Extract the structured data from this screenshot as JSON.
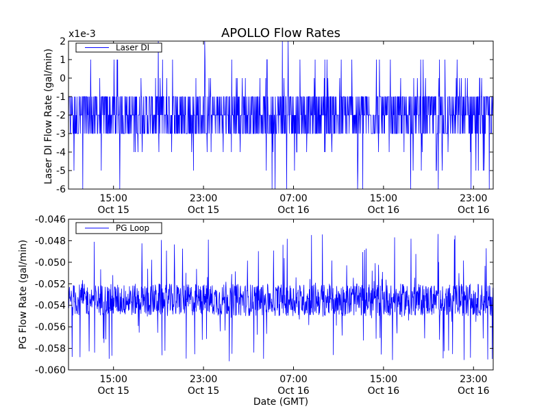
{
  "chart_data": [
    {
      "type": "line",
      "title": "APOLLO Flow Rates",
      "offset_label": "x1e-3",
      "ylabel": "Laser DI Flow Rate (gal/min)",
      "xlabel": "",
      "ylim": [
        -6,
        2
      ],
      "yticks": [
        -6,
        -5,
        -4,
        -3,
        -2,
        -1,
        0,
        1,
        2
      ],
      "ytick_labels": [
        "-6",
        "-5",
        "-4",
        "-3",
        "-2",
        "-1",
        "0",
        "1",
        "2"
      ],
      "xlim": [
        "2011-10-15 11:00",
        "2011-10-17 00:45"
      ],
      "xticks": [
        "2011-10-15 15:00",
        "2011-10-15 23:00",
        "2011-10-16 07:00",
        "2011-10-16 15:00",
        "2011-10-16 23:00"
      ],
      "xtick_labels": [
        {
          "time": "15:00",
          "date": "Oct 15"
        },
        {
          "time": "23:00",
          "date": "Oct 15"
        },
        {
          "time": "07:00",
          "date": "Oct 16"
        },
        {
          "time": "15:00",
          "date": "Oct 16"
        },
        {
          "time": "23:00",
          "date": "Oct 16"
        }
      ],
      "legend": {
        "placement": "top-left",
        "entries": [
          "Laser DI"
        ]
      },
      "series": [
        {
          "name": "Laser DI",
          "color": "#0000ff",
          "typical_range": [
            -4,
            0
          ],
          "dominant_values": [
            -3,
            -2,
            -1
          ],
          "minimum": -6,
          "maximum": 2
        }
      ],
      "grid": false
    },
    {
      "type": "line",
      "title": "",
      "ylabel": "PG Flow Rate (gal/min)",
      "xlabel": "Date (GMT)",
      "ylim": [
        -0.06,
        -0.046
      ],
      "yticks": [
        -0.06,
        -0.058,
        -0.056,
        -0.054,
        -0.052,
        -0.05,
        -0.048,
        -0.046
      ],
      "ytick_labels": [
        "-0.060",
        "-0.058",
        "-0.056",
        "-0.054",
        "-0.052",
        "-0.050",
        "-0.048",
        "-0.046"
      ],
      "xlim": [
        "2011-10-15 11:00",
        "2011-10-17 00:45"
      ],
      "xticks": [
        "2011-10-15 15:00",
        "2011-10-15 23:00",
        "2011-10-16 07:00",
        "2011-10-16 15:00",
        "2011-10-16 23:00"
      ],
      "xtick_labels": [
        {
          "time": "15:00",
          "date": "Oct 15"
        },
        {
          "time": "23:00",
          "date": "Oct 15"
        },
        {
          "time": "07:00",
          "date": "Oct 16"
        },
        {
          "time": "15:00",
          "date": "Oct 16"
        },
        {
          "time": "23:00",
          "date": "Oct 16"
        }
      ],
      "legend": {
        "placement": "top-left",
        "entries": [
          "PG Loop"
        ]
      },
      "series": [
        {
          "name": "PG Loop",
          "color": "#0000ff",
          "typical_range": [
            -0.055,
            -0.052
          ],
          "center": -0.0535,
          "minimum": -0.0592,
          "maximum": -0.0473
        }
      ],
      "grid": false
    }
  ]
}
